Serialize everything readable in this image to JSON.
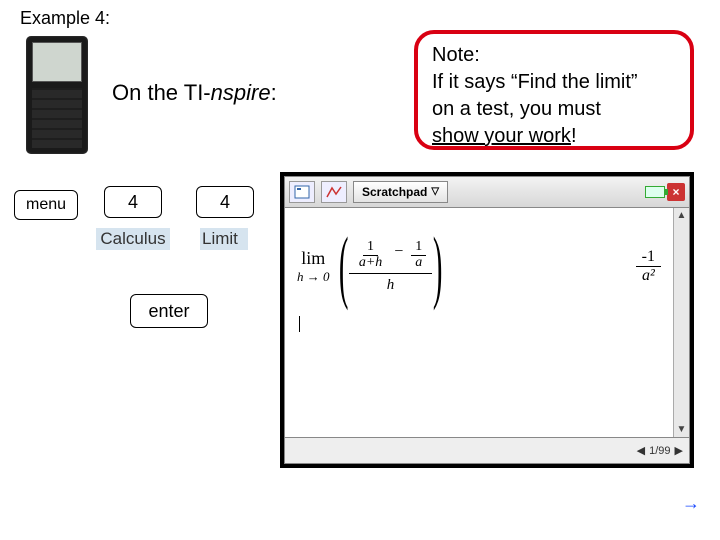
{
  "heading": "Example 4:",
  "subtitle_pre": "On the TI-",
  "subtitle_it": "nspire",
  "subtitle_post": ":",
  "note": {
    "line1": "Note:",
    "line2a": "If it says “Find the limit”",
    "line2b": "on a test, you must",
    "line3": "show your work",
    "bang": "!"
  },
  "keys": {
    "menu": "menu",
    "k1": "4",
    "k2": "4",
    "enter": "enter"
  },
  "captions": {
    "calculus": "Calculus",
    "limit": "Limit"
  },
  "ti": {
    "tab": "Scratchpad",
    "close": "×",
    "page": "1/99",
    "lim_word": "lim",
    "lim_sub": "h → 0",
    "frac1_n": "1",
    "frac1_d": "a+h",
    "minus": "−",
    "frac2_n": "1",
    "frac2_d": "a",
    "outer_den": "h",
    "res_n": "-1",
    "res_d": "a²",
    "scroll_up": "▲",
    "scroll_dn": "▼",
    "status_left": "◀",
    "status_right": "▶"
  },
  "ext_arrow": "→"
}
